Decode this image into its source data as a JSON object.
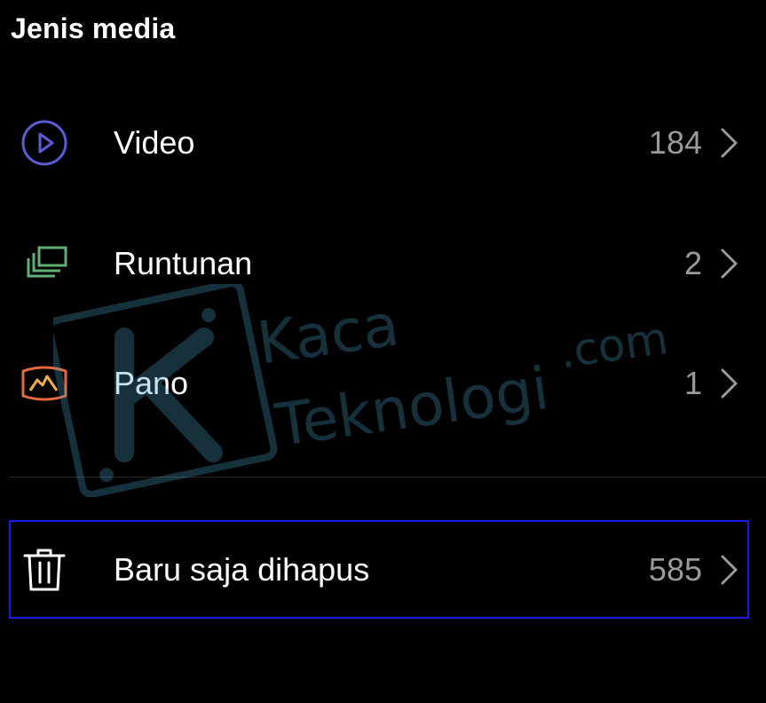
{
  "section": {
    "title": "Jenis media"
  },
  "items": [
    {
      "label": "Video",
      "count": "184",
      "icon": "play-circle-icon",
      "icon_color": "#5b5bd6"
    },
    {
      "label": "Runtunan",
      "count": "2",
      "icon": "stacked-frames-icon",
      "icon_color": "#5fae74"
    },
    {
      "label": "Pano",
      "count": "1",
      "icon": "panorama-mountain-icon",
      "icon_color": "#e86a3a"
    }
  ],
  "recently_deleted": {
    "label": "Baru saja dihapus",
    "count": "585",
    "icon": "trash-icon"
  },
  "watermark": {
    "line1": "Kaca",
    "line2": "Teknologi",
    "suffix": ".com"
  },
  "colors": {
    "background": "#000000",
    "text": "#ffffff",
    "count_text": "#9a9a9a",
    "highlight_border": "#1a1ae6"
  }
}
